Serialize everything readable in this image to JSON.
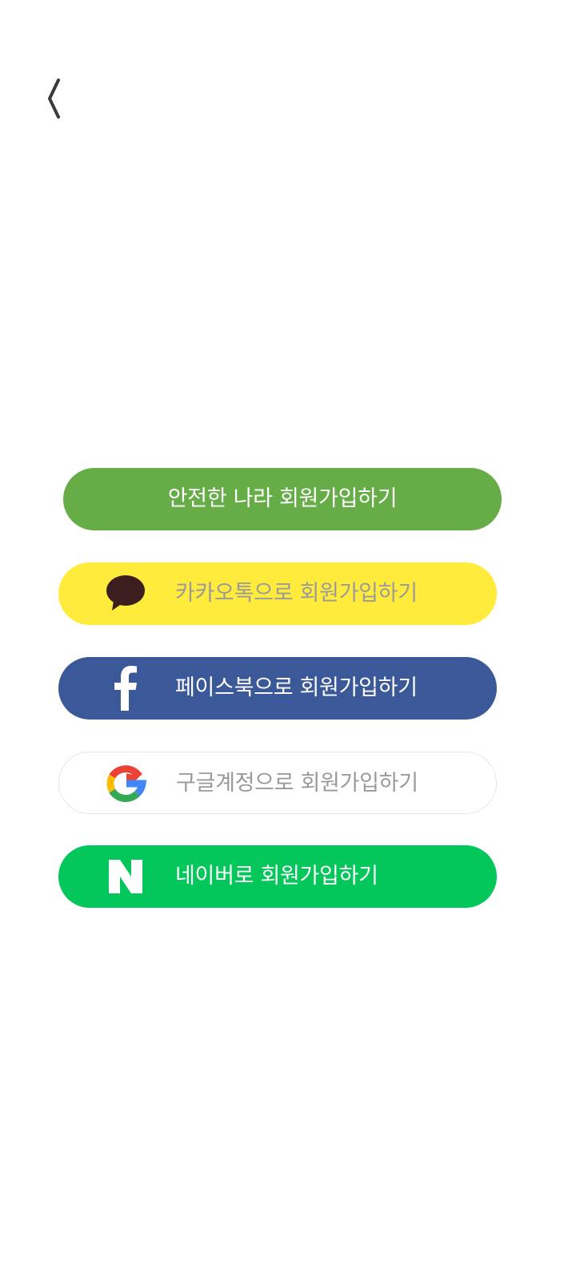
{
  "header": {
    "back_icon": "chevron-left-icon"
  },
  "signup": {
    "buttons": [
      {
        "id": "safe",
        "label": "안전한 나라 회원가입하기",
        "color": "#66ad47",
        "text_color": "#ffffff",
        "icon": null
      },
      {
        "id": "kakao",
        "label": "카카오톡으로 회원가입하기",
        "color": "#ffeb3b",
        "text_color": "#9a9a9a",
        "icon": "kakao-talk-bubble-icon"
      },
      {
        "id": "facebook",
        "label": "페이스북으로 회원가입하기",
        "color": "#3b5998",
        "text_color": "#ffffff",
        "icon": "facebook-f-icon"
      },
      {
        "id": "google",
        "label": "구글계정으로 회원가입하기",
        "color": "#ffffff",
        "text_color": "#9a9a9a",
        "icon": "google-g-icon"
      },
      {
        "id": "naver",
        "label": "네이버로 회원가입하기",
        "color": "#03c75a",
        "text_color": "#ffffff",
        "icon": "naver-n-icon"
      }
    ]
  }
}
